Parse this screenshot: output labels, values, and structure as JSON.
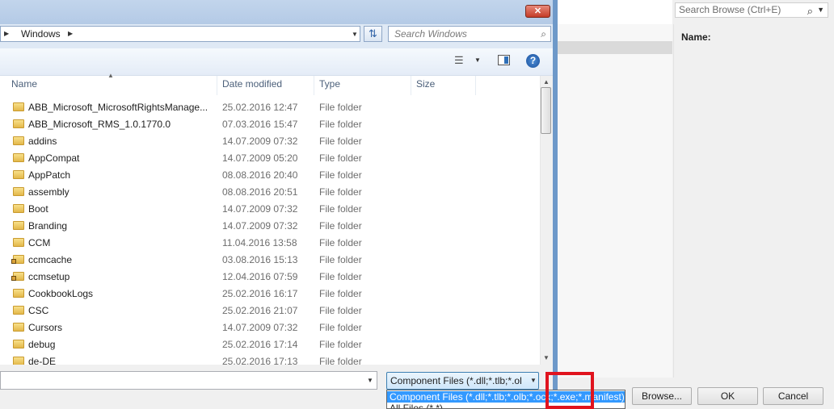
{
  "background_dialog": {
    "search_placeholder": "Search Browse (Ctrl+E)",
    "name_label": "Name:",
    "buttons": {
      "browse": "Browse...",
      "ok": "OK",
      "cancel": "Cancel"
    }
  },
  "file_dialog": {
    "breadcrumb": {
      "current": "Windows"
    },
    "search_placeholder": "Search Windows",
    "columns": {
      "name": "Name",
      "date": "Date modified",
      "type": "Type",
      "size": "Size"
    },
    "rows": [
      {
        "name": "ABB_Microsoft_MicrosoftRightsManage...",
        "date": "25.02.2016 12:47",
        "type": "File folder",
        "locked": false
      },
      {
        "name": "ABB_Microsoft_RMS_1.0.1770.0",
        "date": "07.03.2016 15:47",
        "type": "File folder",
        "locked": false
      },
      {
        "name": "addins",
        "date": "14.07.2009 07:32",
        "type": "File folder",
        "locked": false
      },
      {
        "name": "AppCompat",
        "date": "14.07.2009 05:20",
        "type": "File folder",
        "locked": false
      },
      {
        "name": "AppPatch",
        "date": "08.08.2016 20:40",
        "type": "File folder",
        "locked": false
      },
      {
        "name": "assembly",
        "date": "08.08.2016 20:51",
        "type": "File folder",
        "locked": false
      },
      {
        "name": "Boot",
        "date": "14.07.2009 07:32",
        "type": "File folder",
        "locked": false
      },
      {
        "name": "Branding",
        "date": "14.07.2009 07:32",
        "type": "File folder",
        "locked": false
      },
      {
        "name": "CCM",
        "date": "11.04.2016 13:58",
        "type": "File folder",
        "locked": false
      },
      {
        "name": "ccmcache",
        "date": "03.08.2016 15:13",
        "type": "File folder",
        "locked": true
      },
      {
        "name": "ccmsetup",
        "date": "12.04.2016 07:59",
        "type": "File folder",
        "locked": true
      },
      {
        "name": "CookbookLogs",
        "date": "25.02.2016 16:17",
        "type": "File folder",
        "locked": false
      },
      {
        "name": "CSC",
        "date": "25.02.2016 21:07",
        "type": "File folder",
        "locked": false
      },
      {
        "name": "Cursors",
        "date": "14.07.2009 07:32",
        "type": "File folder",
        "locked": false
      },
      {
        "name": "debug",
        "date": "25.02.2016 17:14",
        "type": "File folder",
        "locked": false
      },
      {
        "name": "de-DE",
        "date": "25.02.2016 17:13",
        "type": "File folder",
        "locked": false
      }
    ],
    "filetype": {
      "selected": "Component Files (*.dll;*.tlb;*.ol",
      "options": [
        "Component Files (*.dll;*.tlb;*.olb;*.ocx;*.exe;*.manifest)",
        "All Files (*.*)"
      ]
    },
    "close_glyph": "✕"
  },
  "colors": {
    "accent": "#3399ff",
    "highlight_box": "#e0141e",
    "dialog_frame": "#6e99c9"
  }
}
